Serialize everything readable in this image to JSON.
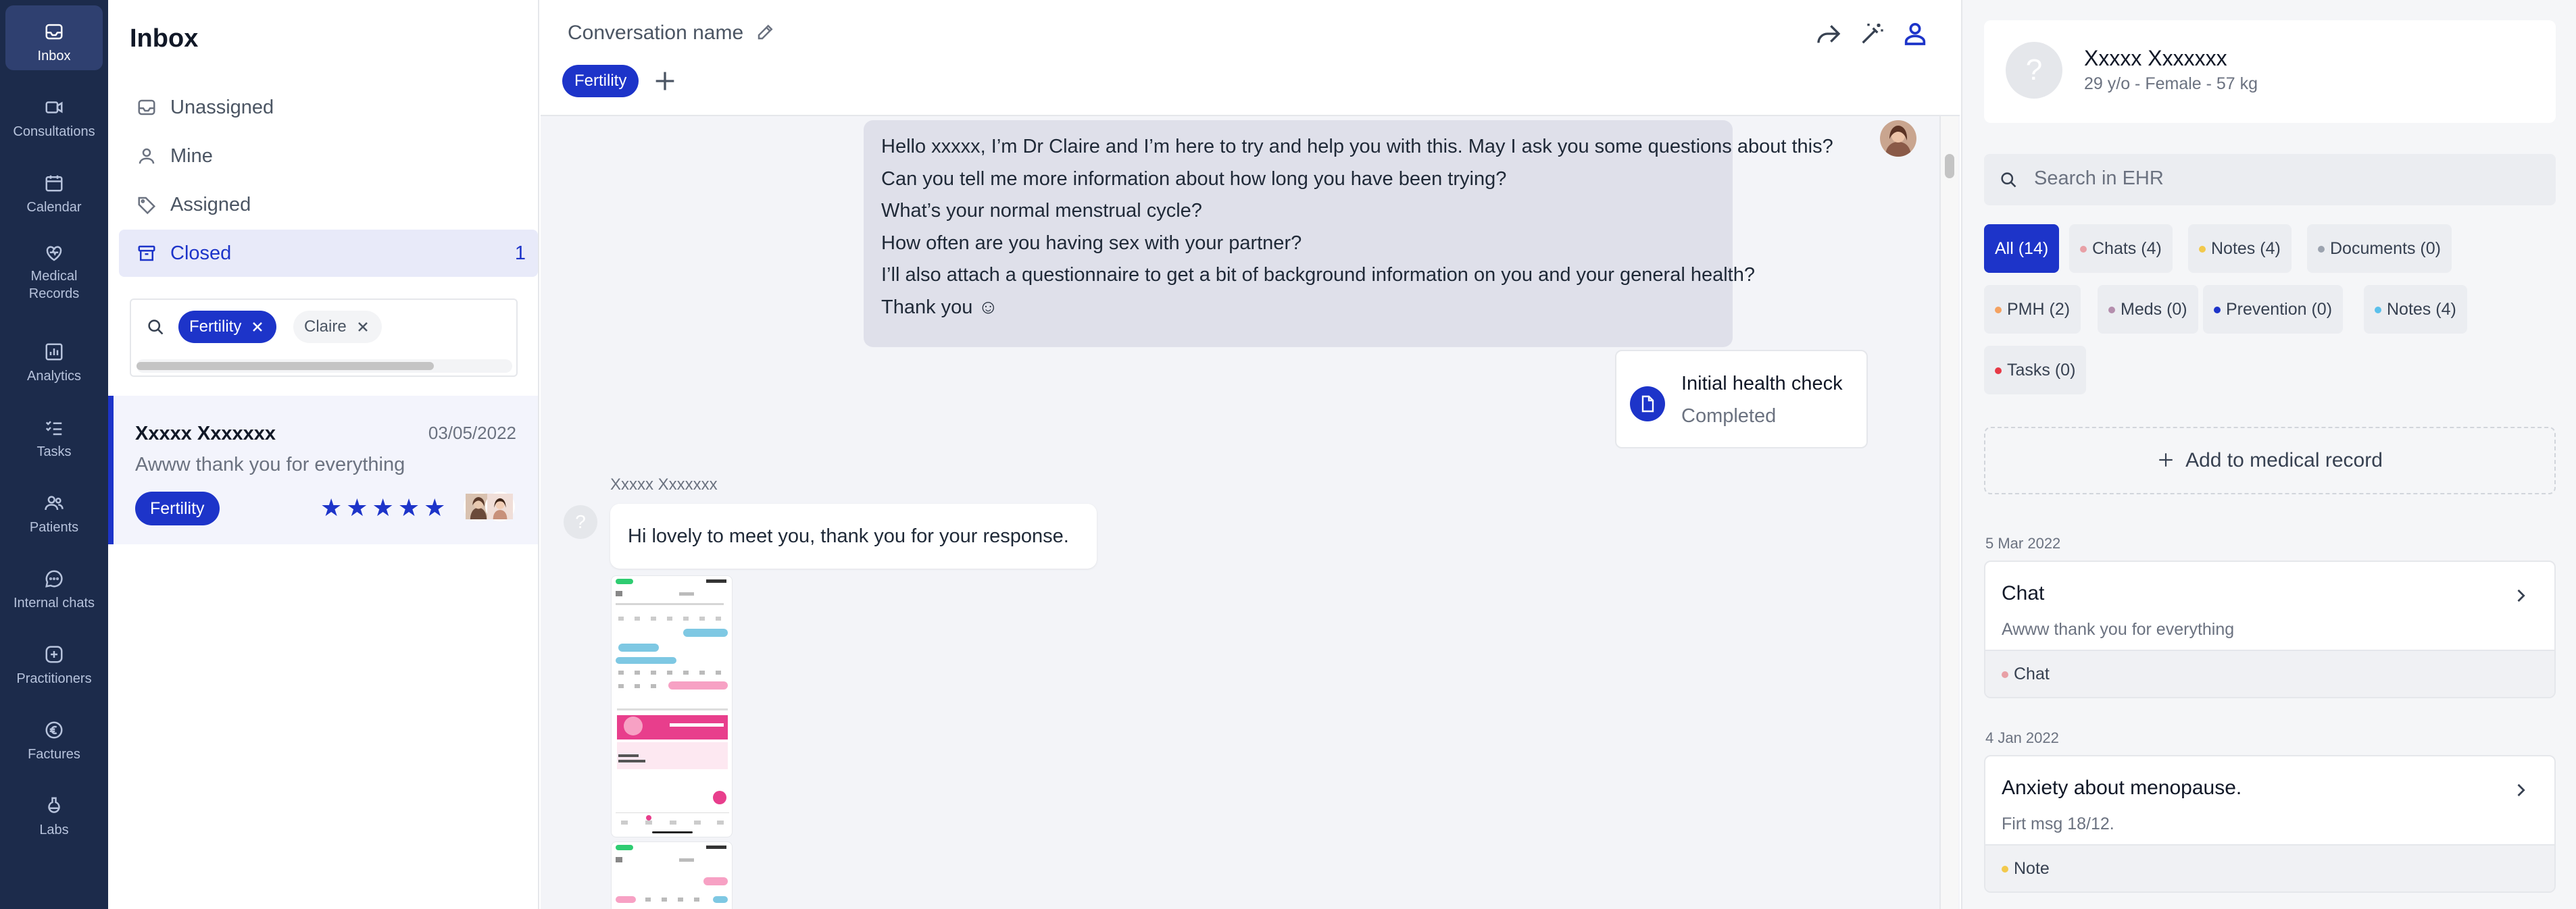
{
  "colors": {
    "accent": "#1d34c9",
    "nav_bg": "#1c2b4b",
    "dot_chats": "#e8a0a6",
    "dot_notes": "#f2c94c",
    "dot_documents": "#9ca3af",
    "dot_pmh": "#f4a261",
    "dot_meds": "#b48ead",
    "dot_prevention": "#1d34c9",
    "dot_notes2": "#5bc0eb",
    "dot_tasks": "#e63946"
  },
  "nav": {
    "items": [
      {
        "label": "Inbox",
        "icon": "inbox-icon"
      },
      {
        "label": "Consultations",
        "icon": "video-icon"
      },
      {
        "label": "Calendar",
        "icon": "calendar-icon"
      },
      {
        "label": "Medical Records",
        "icon": "heart-record-icon"
      },
      {
        "label": "Analytics",
        "icon": "chart-icon"
      },
      {
        "label": "Tasks",
        "icon": "tasks-icon"
      },
      {
        "label": "Patients",
        "icon": "patients-icon"
      },
      {
        "label": "Internal chats",
        "icon": "chat-icon"
      },
      {
        "label": "Practitioners",
        "icon": "practitioner-icon"
      },
      {
        "label": "Factures",
        "icon": "euro-icon"
      },
      {
        "label": "Labs",
        "icon": "flask-icon"
      }
    ]
  },
  "inbox": {
    "title": "Inbox",
    "filters": [
      {
        "label": "Unassigned",
        "icon": "inbox-tray-icon"
      },
      {
        "label": "Mine",
        "icon": "user-icon"
      },
      {
        "label": "Assigned",
        "icon": "tag-icon"
      },
      {
        "label": "Closed",
        "icon": "archive-icon",
        "count": "1"
      }
    ],
    "search_chips": [
      {
        "label": "Fertility"
      },
      {
        "label": "Claire"
      }
    ],
    "conversation": {
      "name": "Xxxxx Xxxxxxx",
      "date": "03/05/2022",
      "preview": "Awww thank you for everything",
      "tag": "Fertility",
      "rating": 5,
      "stars": "★★★★★"
    }
  },
  "conversation": {
    "title": "Conversation name",
    "tag": "Fertility",
    "outgoing_lines": [
      "Hello xxxxx, I’m Dr Claire and I’m here to try and help you with this. May I ask you some questions about this?",
      "Can you tell me more information about how long you have been trying?",
      "What’s your normal menstrual cycle?",
      "How often are you having sex with your partner?",
      "I’ll also attach a questionnaire to get a bit of background information on you and your general health?",
      "Thank you ☺"
    ],
    "health_check": {
      "title": "Initial health check",
      "status": "Completed"
    },
    "incoming": {
      "sender": "Xxxxx Xxxxxxx",
      "avatar": "?",
      "text": "Hi lovely to meet you, thank you for your response."
    }
  },
  "ehr": {
    "patient": {
      "avatar": "?",
      "name": "Xxxxx Xxxxxxx",
      "meta": "29 y/o - Female - 57 kg"
    },
    "search_placeholder": "Search in EHR",
    "tabs": [
      {
        "label": "All (14)"
      },
      {
        "label": "Chats (4)"
      },
      {
        "label": "Notes (4)"
      },
      {
        "label": "Documents (0)"
      },
      {
        "label": "PMH (2)"
      },
      {
        "label": "Meds (0)"
      },
      {
        "label": "Prevention (0)"
      },
      {
        "label": "Notes (4)"
      },
      {
        "label": "Tasks (0)"
      }
    ],
    "add_label": "Add to medical record",
    "records": [
      {
        "date": "5 Mar 2022",
        "title": "Chat",
        "subtitle": "Awww thank you for everything",
        "tag": "Chat"
      },
      {
        "date": "4 Jan 2022",
        "title": "Anxiety about menopause.",
        "subtitle": "Firt msg 18/12.",
        "tag": "Note"
      }
    ]
  }
}
